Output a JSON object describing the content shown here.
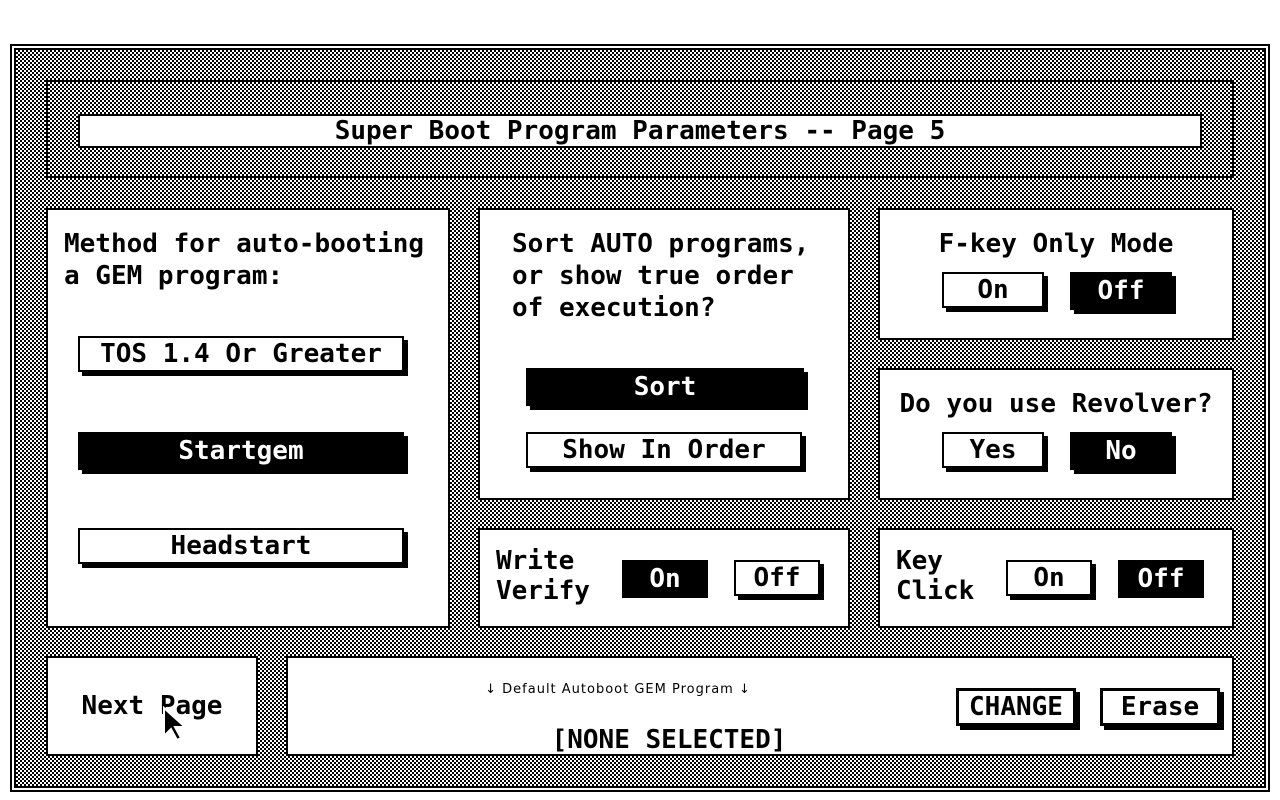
{
  "dialog": {
    "title": "Super Boot Program Parameters -- Page 5"
  },
  "autoboot": {
    "heading": "Method for auto-booting\na GEM program:",
    "options": [
      "TOS 1.4 Or Greater",
      "Startgem",
      "Headstart"
    ],
    "selected": "Startgem"
  },
  "sort_auto": {
    "heading": "Sort AUTO programs,\nor show true order\nof execution?",
    "sort_label": "Sort",
    "show_in_order_label": "Show In Order",
    "selected": "Sort"
  },
  "fkey": {
    "heading": "F-key Only Mode",
    "on_label": "On",
    "off_label": "Off",
    "selected": "Off"
  },
  "revolver": {
    "heading": "Do you use Revolver?",
    "yes_label": "Yes",
    "no_label": "No",
    "selected": "No"
  },
  "write_verify": {
    "heading": "Write\nVerify",
    "on_label": "On",
    "off_label": "Off",
    "selected": "On"
  },
  "key_click": {
    "heading": "Key\nClick",
    "on_label": "On",
    "off_label": "Off",
    "selected": "Off"
  },
  "navigation": {
    "next_page_label": "Next Page"
  },
  "default_program": {
    "label": "↓ Default Autoboot GEM Program ↓",
    "value": "[NONE SELECTED]",
    "change_label": "CHANGE",
    "erase_label": "Erase"
  },
  "icons": {
    "cursor": "mouse-pointer-icon"
  },
  "colors": {
    "foreground": "#000000",
    "background": "#ffffff"
  }
}
